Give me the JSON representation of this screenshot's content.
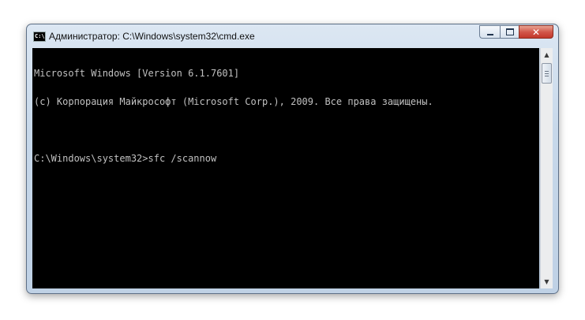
{
  "window": {
    "title": "Администратор: C:\\Windows\\system32\\cmd.exe",
    "icon": "cmd-icon",
    "icon_label": "C:\\",
    "controls": {
      "minimize": "minimize-icon",
      "maximize": "maximize-icon",
      "close": "close-icon"
    }
  },
  "console": {
    "lines": [
      "Microsoft Windows [Version 6.1.7601]",
      "(c) Корпорация Майкрософт (Microsoft Corp.), 2009. Все права защищены.",
      "",
      "C:\\Windows\\system32>sfc /scannow"
    ],
    "background": "#000000",
    "foreground": "#c0c0c0"
  },
  "scrollbar": {
    "up": "scroll-up-arrow-icon",
    "down": "scroll-down-arrow-icon"
  }
}
